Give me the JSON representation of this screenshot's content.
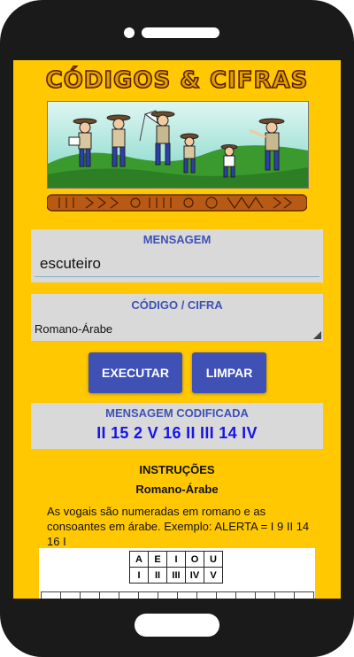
{
  "app": {
    "title": "CÓDIGOS & CIFRAS",
    "banner_image": "scouts-running-illustration",
    "totem_image": "carved-totem-pole"
  },
  "message": {
    "label": "MENSAGEM",
    "value": "escuteiro"
  },
  "code": {
    "label": "CÓDIGO / CIFRA",
    "selected": "Romano-Árabe"
  },
  "buttons": {
    "execute": "EXECUTAR",
    "clear": "LIMPAR"
  },
  "result": {
    "label": "MENSAGEM CODIFICADA",
    "value": "II 15 2 V 16 II III 14 IV"
  },
  "instructions": {
    "title": "INSTRUÇÕES",
    "subtitle": "Romano-Árabe",
    "text": "As vogais são numeradas em romano e as consoantes em árabe. Exemplo: ALERTA = I 9 II 14 16 I",
    "vowels": [
      "A",
      "E",
      "I",
      "O",
      "U"
    ],
    "romans": [
      "I",
      "II",
      "III",
      "IV",
      "V"
    ]
  },
  "colors": {
    "background": "#FFC800",
    "accent": "#3F51B5",
    "result": "#1515E8",
    "panel": "#D9D9D9"
  }
}
